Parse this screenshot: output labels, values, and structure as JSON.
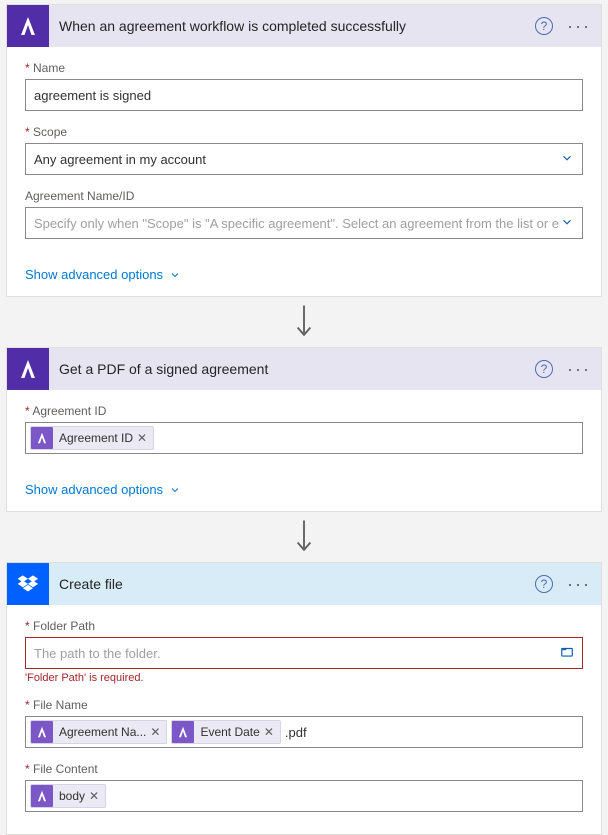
{
  "step1": {
    "title": "When an agreement workflow is completed successfully",
    "fields": {
      "name": {
        "label": "Name",
        "value": "agreement is signed"
      },
      "scope": {
        "label": "Scope",
        "value": "Any agreement in my account"
      },
      "agreement": {
        "label": "Agreement Name/ID",
        "placeholder": "Specify only when \"Scope\" is \"A specific agreement\". Select an agreement from the list or enter th"
      }
    },
    "advanced": "Show advanced options"
  },
  "step2": {
    "title": "Get a PDF of a signed agreement",
    "fields": {
      "agreementId": {
        "label": "Agreement ID",
        "token": "Agreement ID"
      }
    },
    "advanced": "Show advanced options"
  },
  "step3": {
    "title": "Create file",
    "fields": {
      "folderPath": {
        "label": "Folder Path",
        "placeholder": "The path to the folder.",
        "error": "'Folder Path' is required."
      },
      "fileName": {
        "label": "File Name",
        "tokens": [
          "Agreement Na...",
          "Event Date"
        ],
        "suffix": ".pdf"
      },
      "fileContent": {
        "label": "File Content",
        "token": "body"
      }
    }
  }
}
